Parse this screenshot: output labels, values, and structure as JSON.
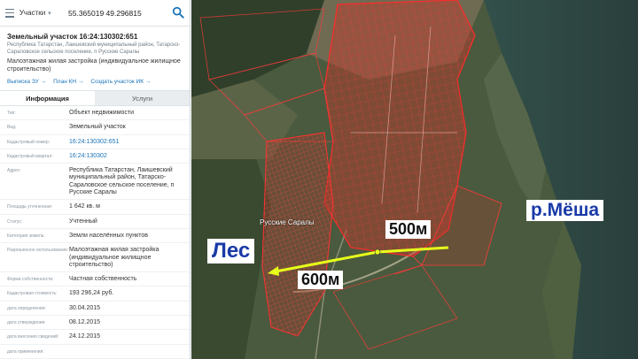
{
  "search": {
    "type_label": "Участки",
    "query": "55.365019 49.296815"
  },
  "object": {
    "title": "Земельный участок 16:24:130302:651",
    "address_short": "Республика Татарстан, Лаишевский муниципальный район, Татарско-Сараловское сельское поселение, п Русские Саралы",
    "permitted_use": "Малоэтажная жилая застройка (индивидуальное жилищное строительство)",
    "links": [
      "Выписка ЗУ →",
      "План КН →",
      "Создать участок ИК →"
    ]
  },
  "tabs": [
    "Информация",
    "Услуги"
  ],
  "rows": [
    {
      "label": "Тип:",
      "value": "Объект недвижимости"
    },
    {
      "label": "Вид:",
      "value": "Земельный участок"
    },
    {
      "label": "Кадастровый номер:",
      "value": "16:24:130302:651",
      "link": true
    },
    {
      "label": "Кадастровый квартал:",
      "value": "16:24:130302",
      "link": true
    },
    {
      "label": "Адрес:",
      "value": "Республика Татарстан, Лаишевский муниципальный район, Татарско-Сараловское сельское поселение, п Русские Саралы"
    },
    {
      "label": "Площадь уточненная:",
      "value": "1 642 кв. м"
    },
    {
      "label": "Статус:",
      "value": "Учтенный"
    },
    {
      "label": "Категория земель:",
      "value": "Земли населённых пунктов"
    },
    {
      "label": "Разрешенное использование:",
      "value": "Малоэтажная жилая застройка (индивидуальное жилищное строительство)"
    },
    {
      "label": "Форма собственности:",
      "value": "Частная собственность"
    },
    {
      "label": "Кадастровая стоимость:",
      "value": "193 296,24 руб."
    },
    {
      "label": "дата определения:",
      "value": "30.04.2015"
    },
    {
      "label": "дата утверждения:",
      "value": "08.12.2015"
    },
    {
      "label": "дата внесения сведений:",
      "value": "24.12.2015"
    },
    {
      "label": "дата применения:",
      "value": ""
    }
  ],
  "map": {
    "river_label": "р.Мёша",
    "forest_label": "Лес",
    "distance_river": "500м",
    "distance_forest": "600м",
    "village_label": "Русские Саралы",
    "colors": {
      "parcel_fill": "#c0392b",
      "parcel_stroke": "#ff2a2a",
      "distance_line": "#e7ff1a",
      "label_text": "#1a3aa8"
    }
  },
  "icons": {
    "menu": "menu-icon",
    "search": "search-icon",
    "dropdown": "chevron-down-icon"
  }
}
